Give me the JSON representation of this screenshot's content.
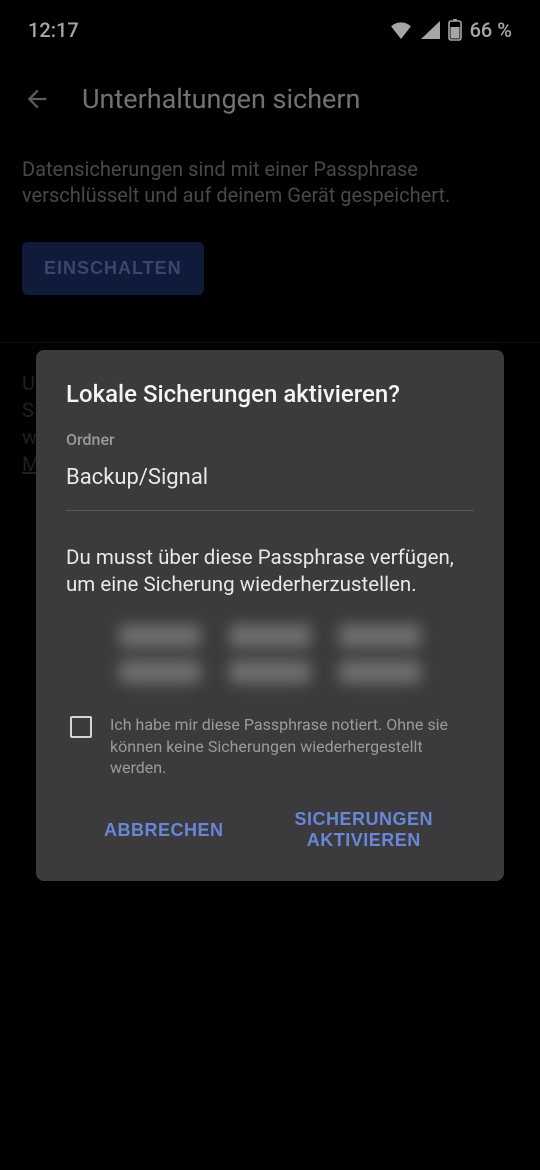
{
  "statusbar": {
    "time": "12:17",
    "battery": "66 %"
  },
  "toolbar": {
    "title": "Unterhaltungen sichern"
  },
  "page": {
    "description": "Datensicherungen sind mit einer Passphrase verschlüsselt und auf deinem Gerät gespeichert.",
    "enable_button": "EINSCHALTEN",
    "bg_text_u": "U",
    "bg_text_s": "S",
    "bg_text_w": "w",
    "bg_text_m": "M"
  },
  "dialog": {
    "title": "Lokale Sicherungen aktivieren?",
    "folder_label": "Ordner",
    "folder_value": "Backup/Signal",
    "instruction": "Du musst über diese Passphrase verfügen, um eine Sicherung wiederherzustellen.",
    "confirm_label": "Ich habe mir diese Passphrase notiert. Ohne sie können keine Sicherungen wiederhergestellt werden.",
    "cancel": "ABBRECHEN",
    "confirm": "SICHERUNGEN AKTIVIEREN"
  }
}
